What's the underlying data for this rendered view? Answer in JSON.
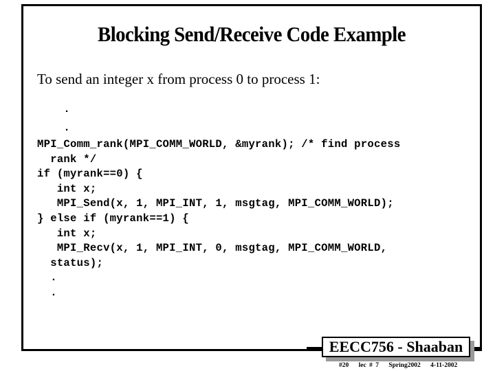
{
  "slide": {
    "title": "Blocking Send/Receive Code Example",
    "intro": "To send an integer x from process 0 to process 1:",
    "code_lines": [
      "    .",
      "    .",
      "MPI_Comm_rank(MPI_COMM_WORLD, &myrank); /* find process",
      "  rank */",
      "if (myrank==0) {",
      "   int x;",
      "   MPI_Send(x, 1, MPI_INT, 1, msgtag, MPI_COMM_WORLD);",
      "} else if (myrank==1) {",
      "   int x;",
      "   MPI_Recv(x, 1, MPI_INT, 0, msgtag, MPI_COMM_WORLD,",
      "  status);",
      "  .",
      "  ."
    ]
  },
  "footer": {
    "badge_label": "EECC756 - Shaaban",
    "slide_number": "#20",
    "lecture": "lec # 7",
    "term": "Spring2002",
    "date": "4-11-2002"
  }
}
